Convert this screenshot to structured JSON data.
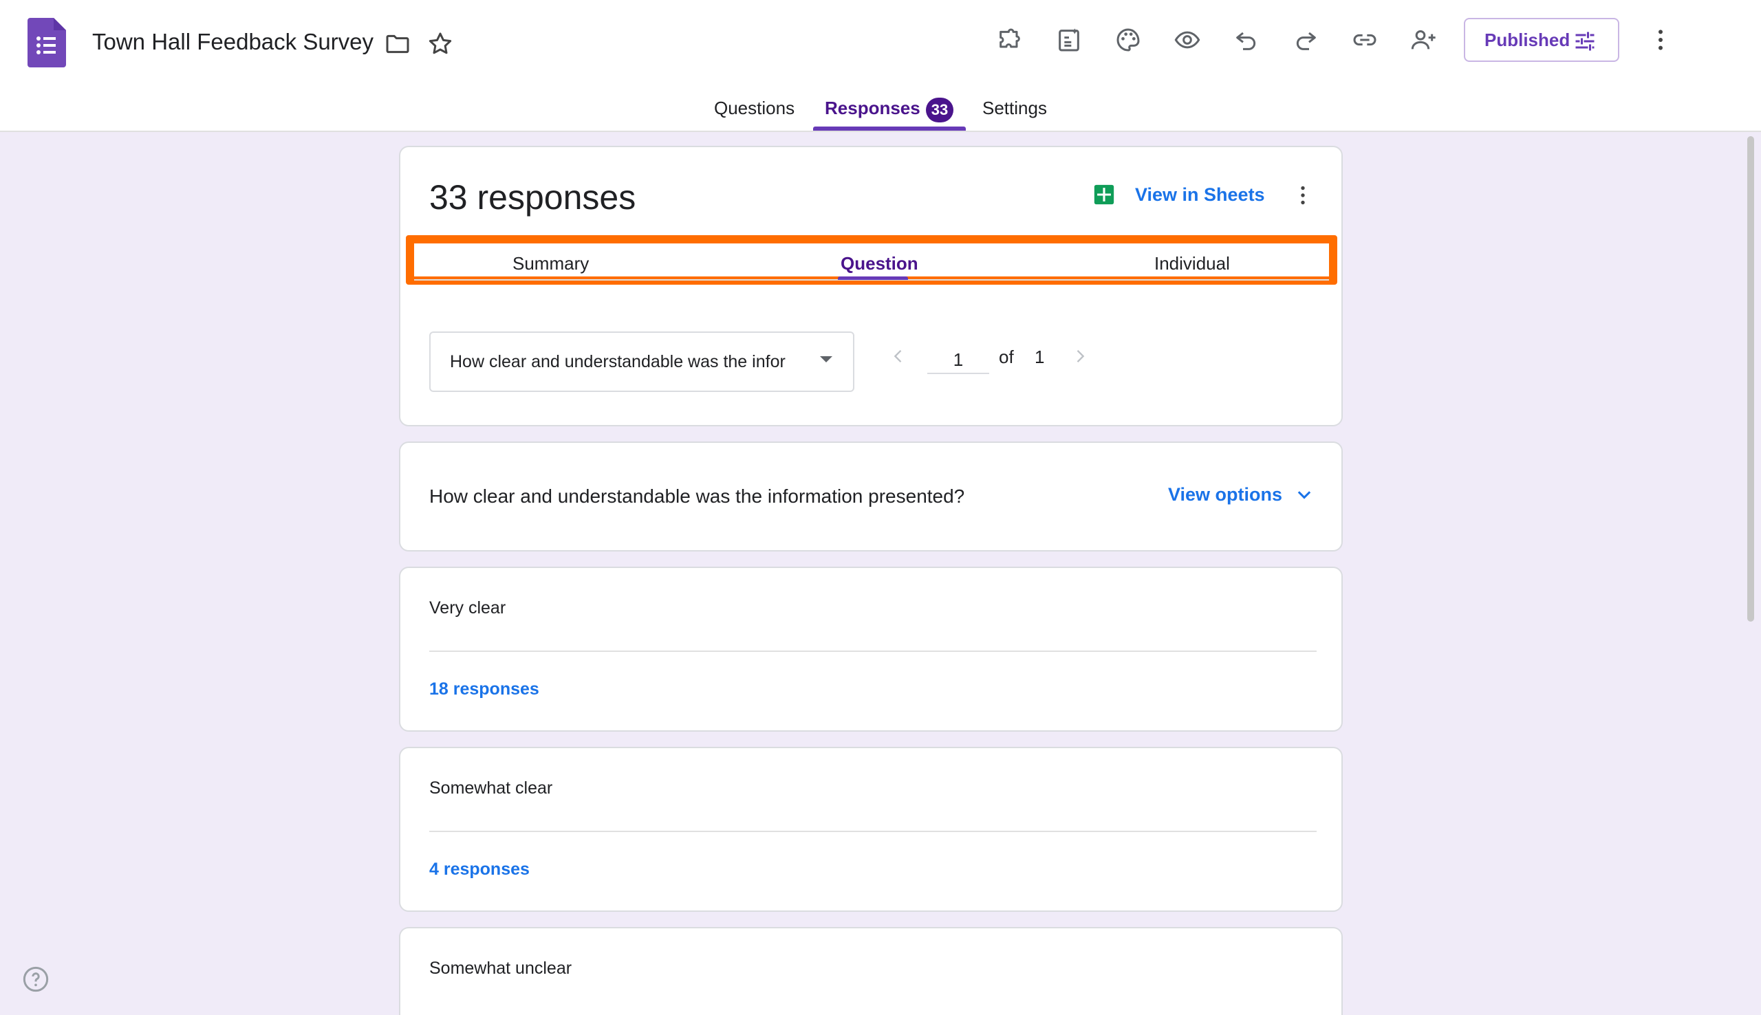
{
  "header": {
    "title": "Town Hall Feedback Survey",
    "publish_label": "Published",
    "toolbar_icons": [
      "addons-icon",
      "ai-form-icon",
      "palette-icon",
      "preview-icon",
      "undo-icon",
      "redo-icon",
      "link-icon",
      "add-collaborator-icon",
      "more-icon"
    ],
    "tabs": [
      {
        "label": "Questions",
        "active": false
      },
      {
        "label": "Responses",
        "active": true,
        "badge": "33"
      },
      {
        "label": "Settings",
        "active": false
      }
    ],
    "accent_color": "#673ab7"
  },
  "responses": {
    "heading": "33 responses",
    "sheets_label": "View in Sheets",
    "subtabs": [
      {
        "label": "Summary",
        "active": false
      },
      {
        "label": "Question",
        "active": true
      },
      {
        "label": "Individual",
        "active": false
      }
    ],
    "highlight_color": "#ff6d00",
    "question_select": "How clear and understandable was the infor",
    "pager": {
      "current": "1",
      "of_label": "of",
      "total": "1"
    }
  },
  "question": {
    "text": "How clear and understandable was the information presented?",
    "view_options_label": "View options"
  },
  "answers": [
    {
      "text": "Very clear",
      "count": "18 responses"
    },
    {
      "text": "Somewhat clear",
      "count": "4 responses"
    },
    {
      "text": "Somewhat unclear",
      "count": ""
    }
  ]
}
